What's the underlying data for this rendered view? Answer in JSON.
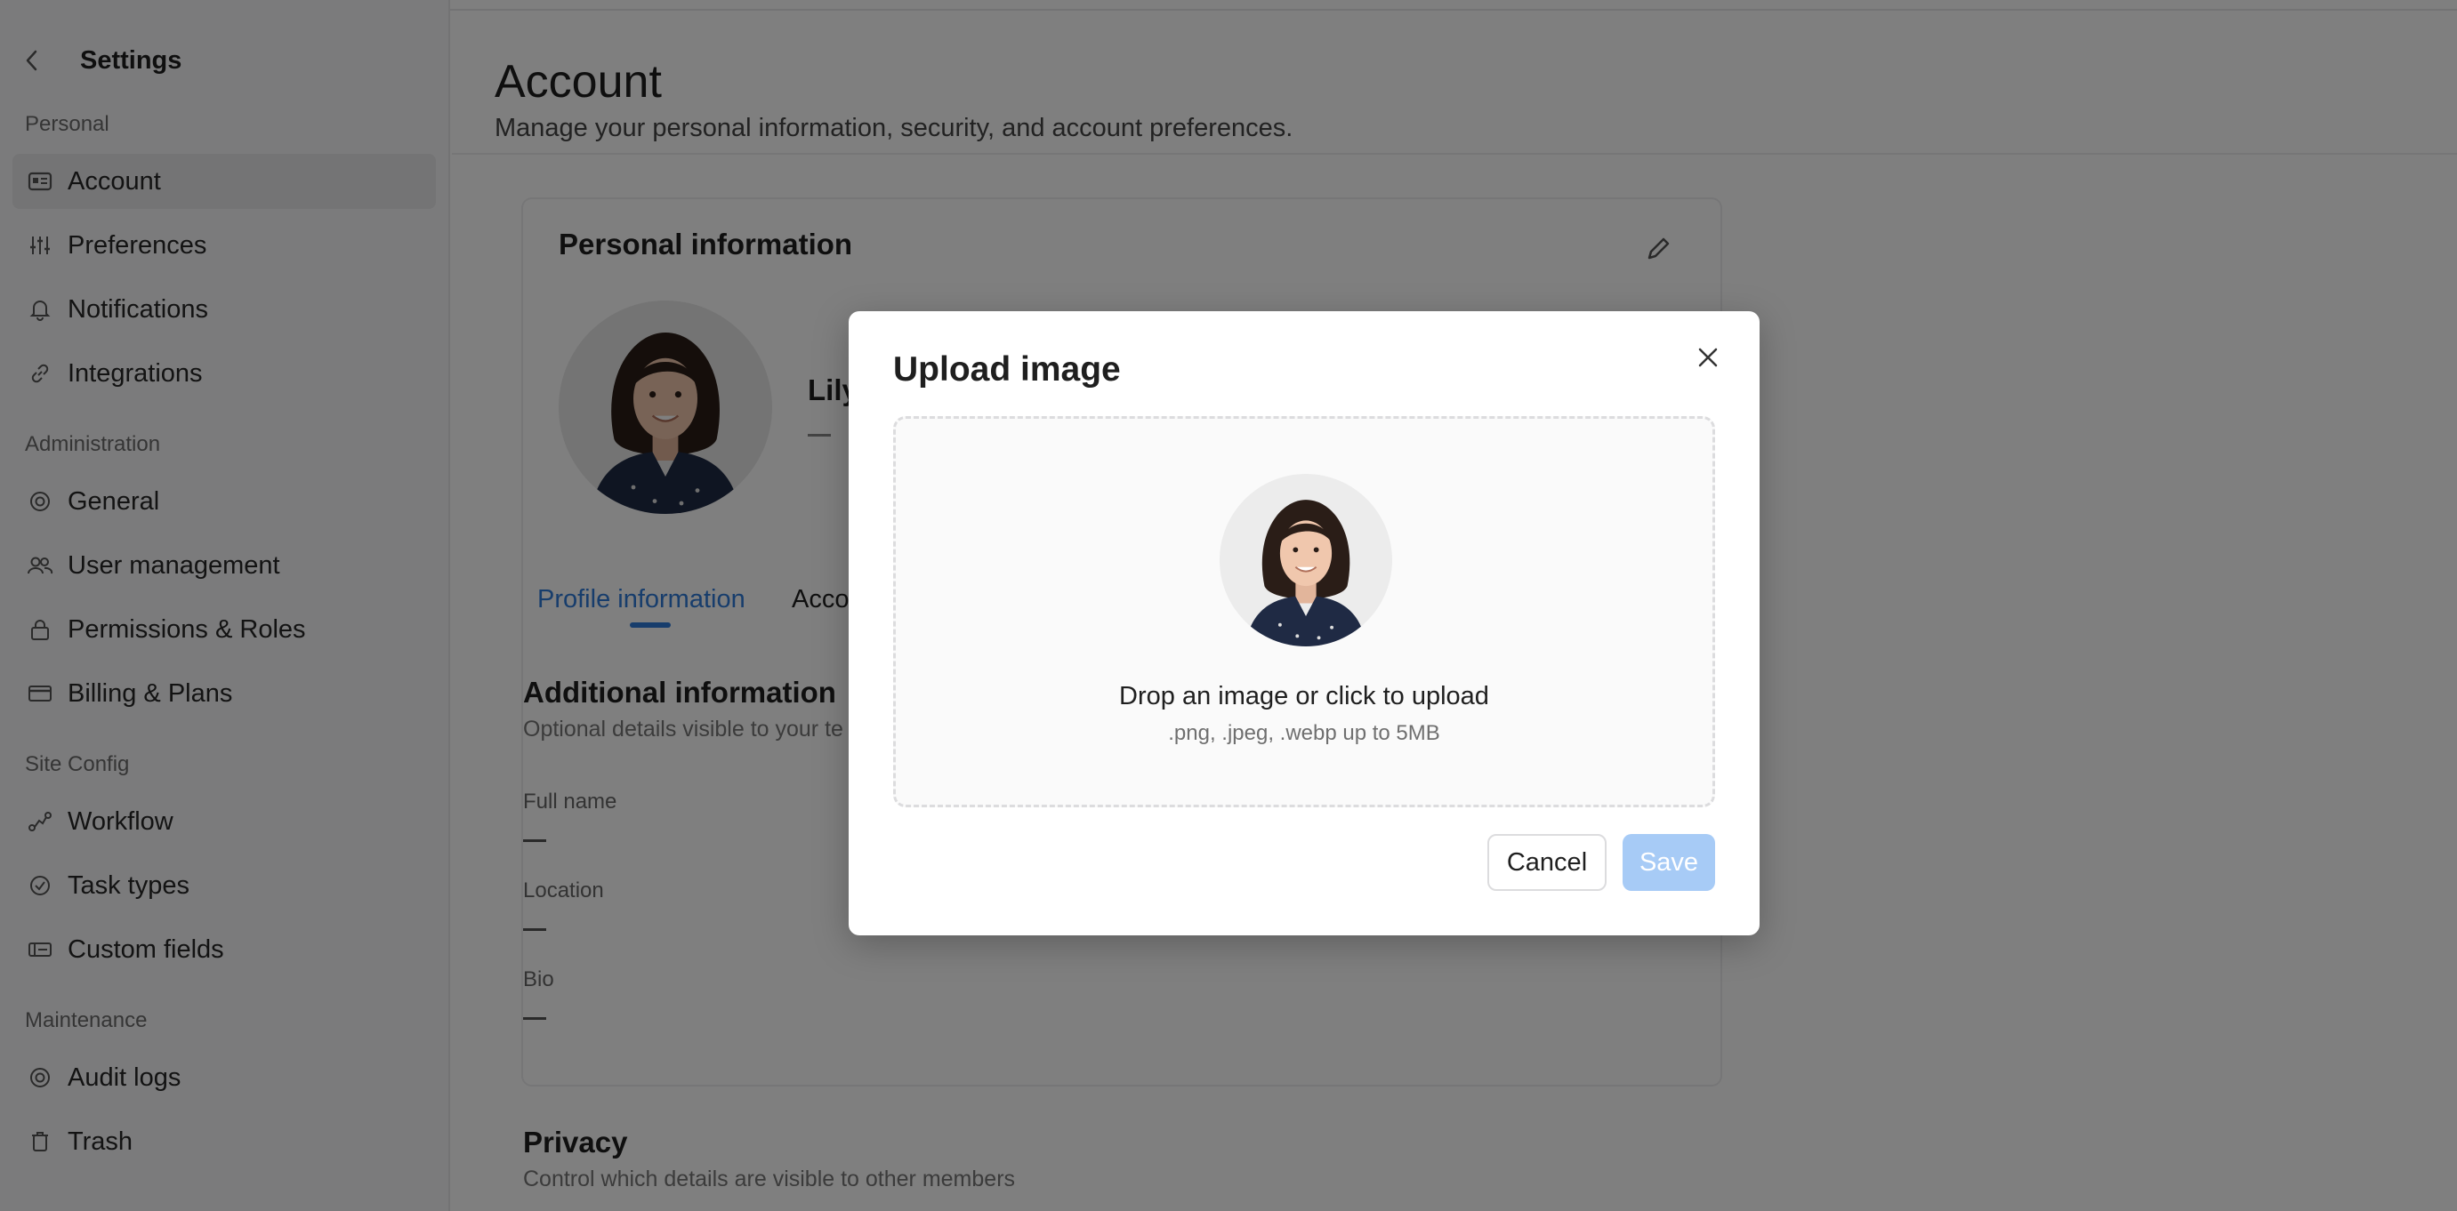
{
  "sidebar": {
    "title": "Settings",
    "sections": [
      {
        "label": "Personal",
        "items": [
          {
            "label": "Account",
            "icon": "id-card-icon",
            "active": true
          },
          {
            "label": "Preferences",
            "icon": "sliders-icon"
          },
          {
            "label": "Notifications",
            "icon": "bell-icon"
          },
          {
            "label": "Integrations",
            "icon": "link-icon"
          }
        ]
      },
      {
        "label": "Administration",
        "items": [
          {
            "label": "General",
            "icon": "gear-icon"
          },
          {
            "label": "User management",
            "icon": "users-icon"
          },
          {
            "label": "Permissions & Roles",
            "icon": "lock-icon"
          },
          {
            "label": "Billing & Plans",
            "icon": "credit-card-icon"
          }
        ]
      },
      {
        "label": "Site Config",
        "items": [
          {
            "label": "Workflow",
            "icon": "workflow-icon"
          },
          {
            "label": "Task types",
            "icon": "check-circle-icon"
          },
          {
            "label": "Custom fields",
            "icon": "tag-fields-icon"
          }
        ]
      },
      {
        "label": "Maintenance",
        "items": [
          {
            "label": "Audit logs",
            "icon": "gear-icon"
          },
          {
            "label": "Trash",
            "icon": "trash-icon"
          }
        ]
      }
    ]
  },
  "main": {
    "title": "Account",
    "subtitle": "Manage your personal information, security, and account preferences.",
    "personal_info": {
      "title": "Personal information",
      "name_partial": "Lily",
      "placeholder_dash": "—"
    },
    "tabs": [
      {
        "label": "Profile information",
        "active": true
      },
      {
        "label": "Acco"
      }
    ],
    "additional": {
      "title": "Additional information",
      "subtitle": "Optional details visible to your te",
      "fields": [
        {
          "label": "Full name",
          "value": "—"
        },
        {
          "label": "Location",
          "value": "—"
        },
        {
          "label": "Bio",
          "value": "—"
        }
      ]
    },
    "privacy": {
      "title": "Privacy",
      "subtitle": "Control which details are visible to other members"
    }
  },
  "modal": {
    "title": "Upload image",
    "dropzone": {
      "title": "Drop an image or click to upload",
      "subtitle": ".png, .jpeg, .webp up to 5MB"
    },
    "cancel_label": "Cancel",
    "save_label": "Save"
  },
  "colors": {
    "accent": "#2f7ad8",
    "save_disabled": "#a7cbf6",
    "overlay": "rgba(0,0,0,0.5)"
  }
}
